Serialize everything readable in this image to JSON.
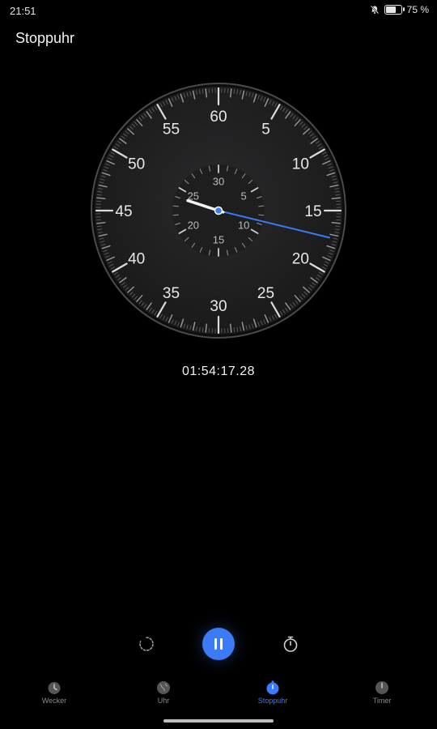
{
  "status_bar": {
    "time": "21:51",
    "battery_level_percent": 75,
    "battery_label": "75 %",
    "icons": [
      "bell-off-icon",
      "battery-icon"
    ]
  },
  "header": {
    "title": "Stoppuhr"
  },
  "stopwatch": {
    "dial_labels": [
      "60",
      "5",
      "10",
      "15",
      "20",
      "25",
      "30",
      "35",
      "40",
      "45",
      "50",
      "55"
    ],
    "subdial_labels": [
      "30",
      "5",
      "10",
      "15",
      "20",
      "25"
    ],
    "elapsed": "01:54:17.28",
    "hand_seconds": 17.28,
    "subdial_minutes": 54,
    "accent": "#3b7bf7"
  },
  "controls": {
    "lap_icon": "lap-reset-icon",
    "pause_icon": "pause-icon",
    "timer_icon": "stopwatch-icon"
  },
  "bottom_nav": {
    "items": [
      {
        "label": "Wecker",
        "icon": "alarm-clock-icon"
      },
      {
        "label": "Uhr",
        "icon": "globe-icon"
      },
      {
        "label": "Stoppuhr",
        "icon": "stopwatch-icon"
      },
      {
        "label": "Timer",
        "icon": "timer-icon"
      }
    ],
    "active_index": 2
  }
}
